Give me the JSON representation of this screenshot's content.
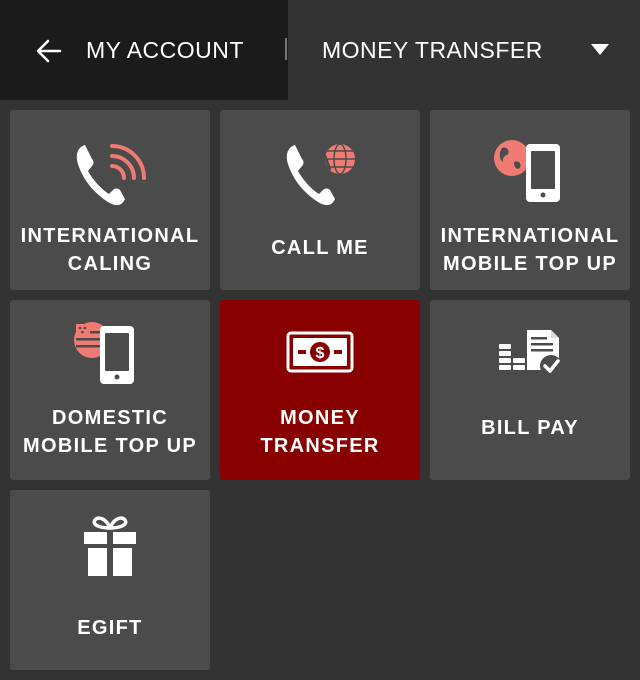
{
  "header": {
    "back_label": "MY ACCOUNT",
    "section_title": "MONEY TRANSFER"
  },
  "colors": {
    "background": "#333333",
    "header_left": "#1b1b1b",
    "tile": "#4b4b4b",
    "tile_active": "#880000",
    "accent": "#f07b72"
  },
  "tiles": [
    {
      "label": "INTERNATIONAL\nCALING",
      "icon": "phone-wifi-icon"
    },
    {
      "label": "CALL ME",
      "icon": "phone-globe-icon"
    },
    {
      "label": "INTERNATIONAL\nMOBILE TOP UP",
      "icon": "globe-mobile-icon"
    },
    {
      "label": "DOMESTIC\nMOBILE TOP UP",
      "icon": "flag-mobile-icon"
    },
    {
      "label": "MONEY\nTRANSFER",
      "icon": "money-bill-icon",
      "selected": true
    },
    {
      "label": "BILL PAY",
      "icon": "bill-coins-icon"
    },
    {
      "label": "EGIFT",
      "icon": "gift-icon"
    }
  ]
}
